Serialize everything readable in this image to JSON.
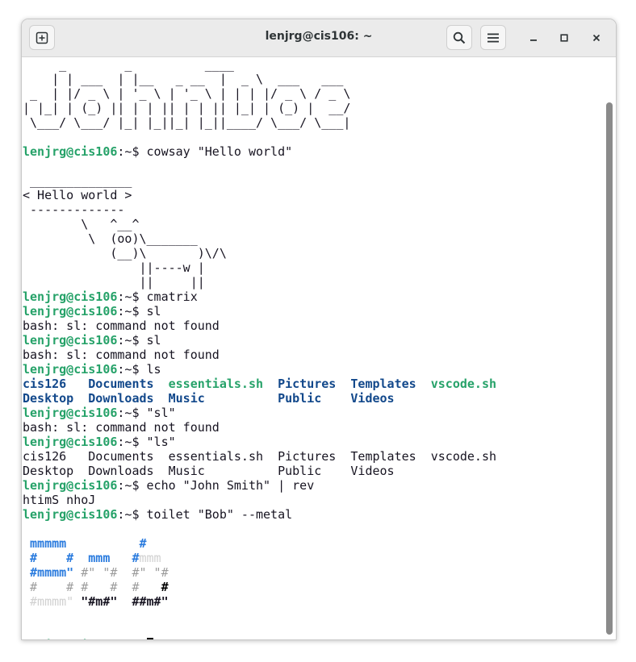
{
  "window": {
    "title": "lenjrg@cis106: ~",
    "buttons": {
      "new_tab_icon": "new-tab-icon",
      "search_icon": "search-icon",
      "menu_icon": "hamburger-menu-icon",
      "minimize_icon": "minimize-icon",
      "maximize_icon": "maximize-icon",
      "close_icon": "close-icon"
    }
  },
  "colors": {
    "prompt": "#26a269",
    "directory": "#12488b",
    "executable": "#26a269",
    "text": "#171421",
    "metal_blue": "#2a7bde",
    "metal_grey": "#9c9c9c",
    "metal_light": "#d0d0d0"
  },
  "terminal": {
    "prompt": "lenjrg@cis106",
    "prompt_suffix": ":~$ ",
    "banner": [
      "     _        _          ____",
      "    | | ___  | |__   _ __  |  _ \\  ___   ___",
      " _  | |/ _ \\ | '_ \\ | '_ \\ | | | |/ _ \\ / _ \\",
      "| |_| | (_) || | | || | | || |_| | (_) |  __/",
      " \\___/ \\___/ |_| |_||_| |_||____/ \\___/ \\___|"
    ],
    "cmd_cowsay": "cowsay \"Hello world\"",
    "cow": [
      " ______________",
      "< Hello world >",
      " -------------",
      "        \\   ^__^",
      "         \\  (oo)\\_______",
      "            (__)\\       )\\/\\",
      "                ||----w |",
      "                ||     ||"
    ],
    "cmd_cmatrix": "cmatrix",
    "cmd_sl1": "sl",
    "err_sl1": "bash: sl: command not found",
    "cmd_sl2": "sl",
    "err_sl2": "bash: sl: command not found",
    "cmd_ls": "ls",
    "ls_row1": {
      "c1": "cis126",
      "g1": "   ",
      "c2": "Documents",
      "g2": "  ",
      "c3": "essentials.sh",
      "g3": "  ",
      "c4": "Pictures",
      "g4": "  ",
      "c5": "Templates",
      "g5": "  ",
      "c6": "vscode.sh"
    },
    "ls_row2": {
      "c1": "Desktop",
      "g1": "  ",
      "c2": "Downloads",
      "g2": "  ",
      "c3": "Music",
      "g3": "          ",
      "c4": "Public",
      "g4": "    ",
      "c5": "Videos"
    },
    "cmd_quoted_sl": "\"sl\"",
    "err_quoted_sl": "bash: sl: command not found",
    "cmd_quoted_ls": "\"ls\"",
    "ls_plain_1": "cis126   Documents  essentials.sh  Pictures  Templates  vscode.sh",
    "ls_plain_2": "Desktop  Downloads  Music          Public    Videos",
    "cmd_rev": "echo \"John Smith\" | rev",
    "rev_output": "htimS nhoJ",
    "cmd_toilet": "toilet \"Bob\" --metal",
    "metal": {
      "l1_a": " mmmmm",
      "l1_b": "          ",
      "l1_c": "#",
      "l2_a": " #    #",
      "l2_b": "  mmm   ",
      "l2_c": "#",
      "l2_d": "mmm",
      "l3_a": " #mmmm\"",
      "l3_b": " #\" \"#",
      "l3_c": "  #\" \"#",
      "l4_a": " #    # #   #",
      "l4_b": "  #   ",
      "l4_c": "#",
      "l5_a": " #mmmm\"",
      "l5_b": " \"#m#\"",
      "l5_c": "  ##m#\""
    },
    "final_prompt_note": ""
  }
}
